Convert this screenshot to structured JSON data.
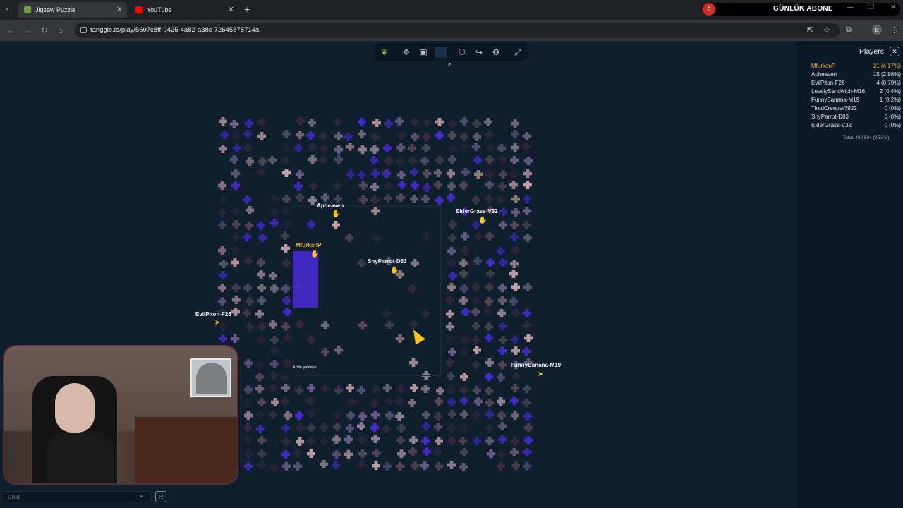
{
  "browser": {
    "tabs": [
      {
        "label": "Jigsaw Puzzle",
        "active": true
      },
      {
        "label": "YouTube",
        "active": false
      }
    ],
    "url": "tanggle.io/play/5697c8ff-0425-4a82-a38c-72645875714a"
  },
  "overlay": {
    "subscriber_count": "0",
    "subscriber_label": "GÜNLÜK ABONE"
  },
  "game": {
    "toolbar_icons": [
      "leaf-logo-icon",
      "puzzle-piece-icon",
      "image-preview-icon",
      "box-icon",
      "players-icon",
      "share-icon",
      "settings-icon",
      "fullscreen-icon"
    ],
    "cursors": [
      {
        "name": "Apheaven"
      },
      {
        "name": "ElderGrass-V32"
      },
      {
        "name": "MfurkanP"
      },
      {
        "name": "ShyParrot-D83"
      },
      {
        "name": "EvilPiton-F26"
      },
      {
        "name": "FunnyBanana-M19"
      }
    ],
    "chat_note": "köfte yemeye"
  },
  "players": {
    "title": "Players",
    "list": [
      {
        "name": "MfurkanP",
        "score": "21 (4.17%)"
      },
      {
        "name": "Apheaven",
        "score": "15 (2.98%)"
      },
      {
        "name": "EvilPiton-F26",
        "score": "4 (0.79%)"
      },
      {
        "name": "LovelySandwich-M16",
        "score": "2 (0.4%)"
      },
      {
        "name": "FunnyBanana-M19",
        "score": "1 (0.2%)"
      },
      {
        "name": "TiredCreeper7922",
        "score": "0 (0%)"
      },
      {
        "name": "ShyParrot-D83",
        "score": "0 (0%)"
      },
      {
        "name": "ElderGrass-V32",
        "score": "0 (0%)"
      }
    ],
    "total": "Total: 43 / 504 (8.53%)"
  },
  "chat": {
    "placeholder": "Chat"
  },
  "colors": {
    "accent_orange": "#f0b132",
    "cursor_yellow": "#f5c518",
    "piece_purple": "#4a2bd9",
    "piece_pink": "#c9a3a6"
  }
}
